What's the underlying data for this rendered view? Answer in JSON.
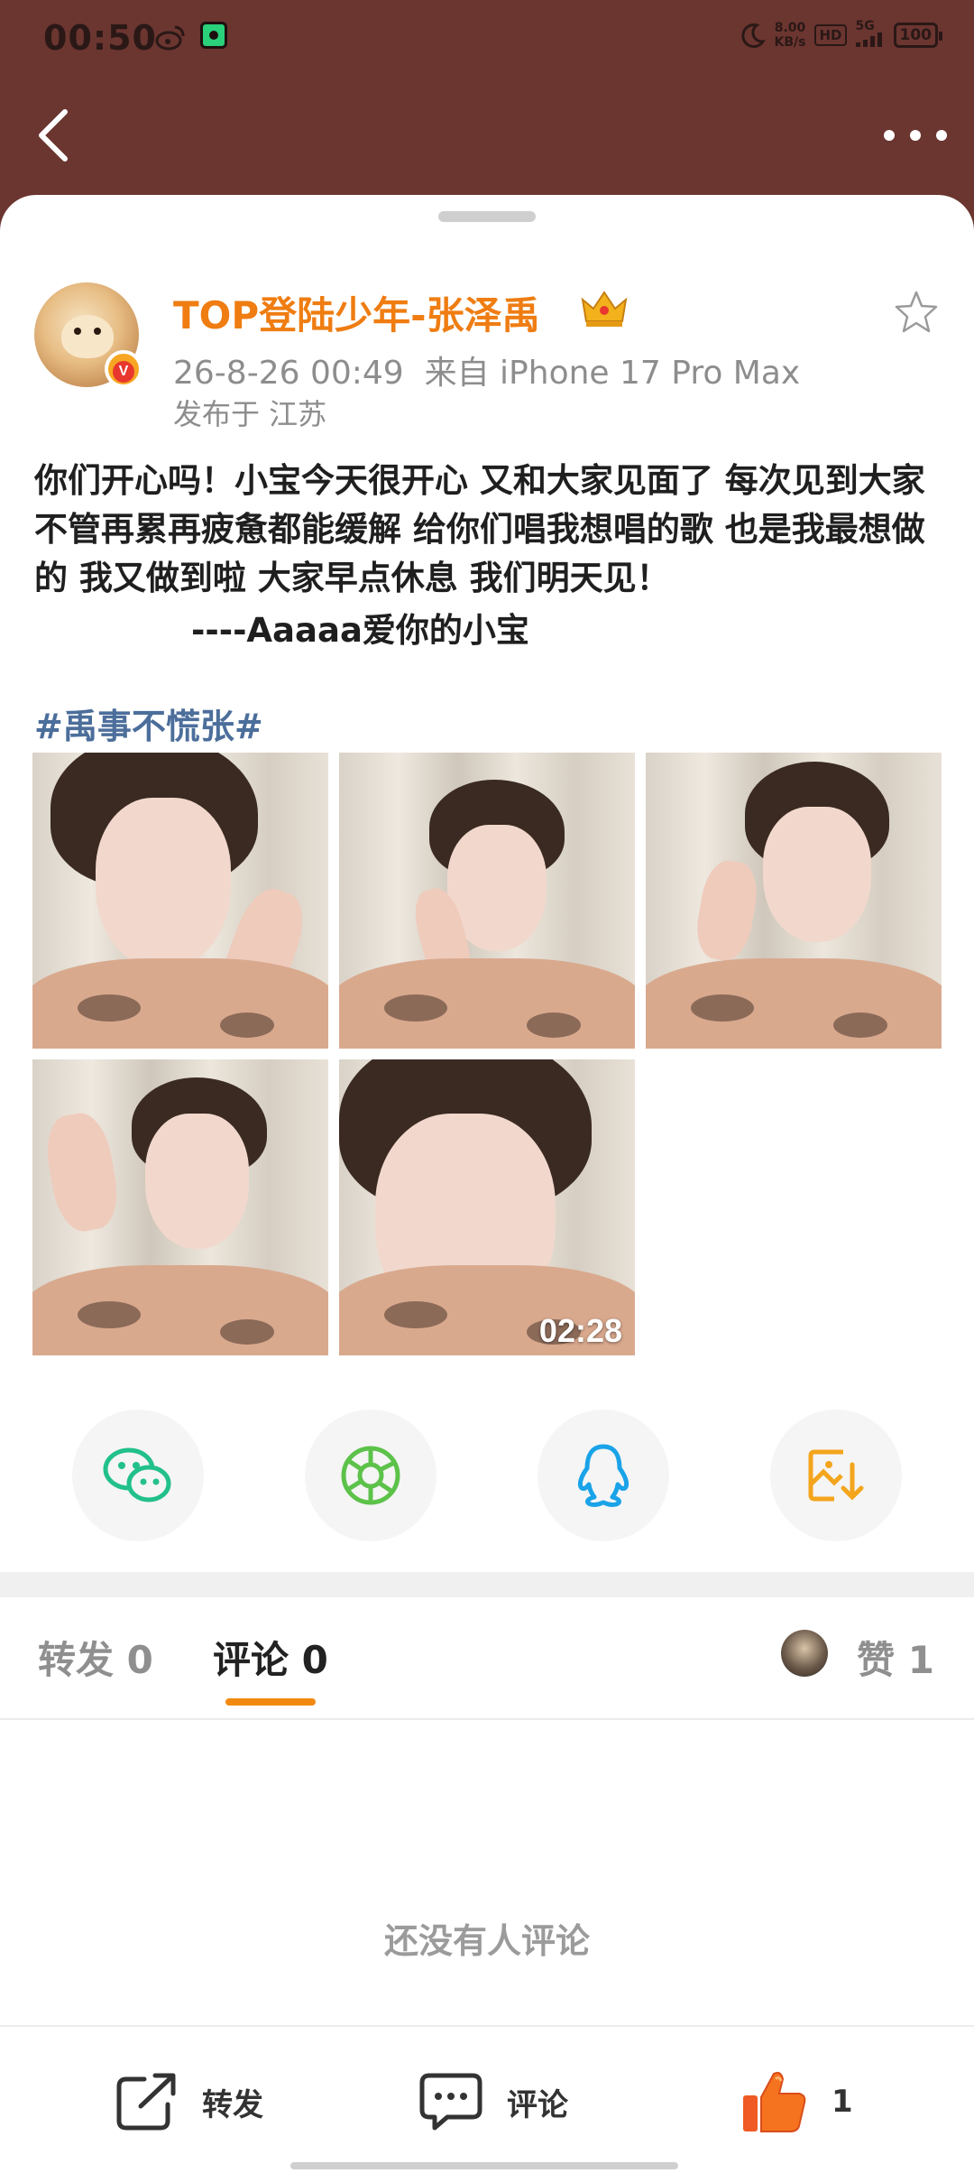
{
  "status_bar": {
    "time": "00:50",
    "net_speed_value": "8.00",
    "net_speed_unit": "KB/s",
    "hd": "HD",
    "signal": "5G",
    "battery": "100"
  },
  "post": {
    "username": "TOP登陆少年-张泽禹",
    "timestamp": "26-8-26 00:49",
    "source": "来自 iPhone 17 Pro Max",
    "location": "发布于 江苏",
    "text": "你们开心吗！小宝今天很开心 又和大家见面了 每次见到大家不管再累再疲惫都能缓解 给你们唱我想唱的歌 也是我最想做的 我又做到啦 大家早点休息 我们明天见！",
    "signature": "----Aaaaa爱你的小宝",
    "hashtag": "#禹事不慌张#",
    "video_duration": "02:28"
  },
  "share_targets": [
    "wechat-icon",
    "moments-icon",
    "qq-icon",
    "save-image-icon"
  ],
  "tabs": {
    "repost_label": "转发",
    "repost_count": "0",
    "comment_label": "评论",
    "comment_count": "0",
    "like_label": "赞",
    "like_count": "1"
  },
  "empty_comments": "还没有人评论",
  "bottom_bar": {
    "repost_label": "转发",
    "comment_label": "评论",
    "like_count": "1"
  },
  "colors": {
    "header_bg": "#6b3530",
    "username": "#ef7d12",
    "hashtag": "#4c6e9b",
    "tab_indicator": "#f28a12"
  }
}
